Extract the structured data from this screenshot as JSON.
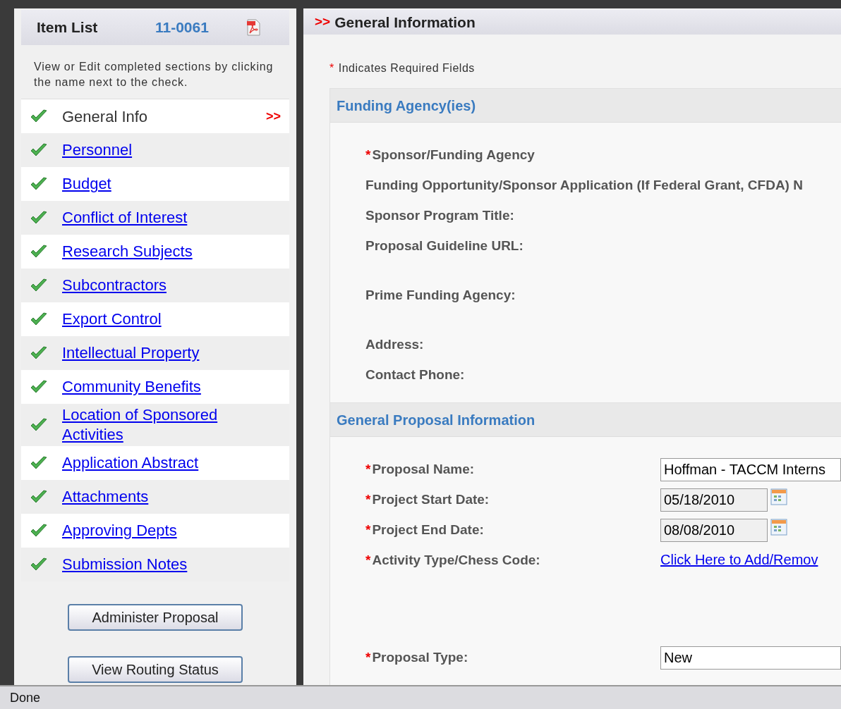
{
  "sidebar": {
    "title": "Item List",
    "proposal_number": "11-0061",
    "hint": "View or Edit completed sections by clicking the name next to the check.",
    "items": [
      {
        "label": "General Info",
        "complete": true,
        "selected": true,
        "marker": ">>"
      },
      {
        "label": "Personnel",
        "complete": true,
        "selected": false
      },
      {
        "label": "Budget",
        "complete": true,
        "selected": false
      },
      {
        "label": "Conflict of Interest",
        "complete": true,
        "selected": false
      },
      {
        "label": "Research Subjects",
        "complete": true,
        "selected": false
      },
      {
        "label": "Subcontractors",
        "complete": true,
        "selected": false
      },
      {
        "label": "Export Control",
        "complete": true,
        "selected": false
      },
      {
        "label": "Intellectual Property",
        "complete": true,
        "selected": false
      },
      {
        "label": "Community Benefits",
        "complete": true,
        "selected": false
      },
      {
        "label": "Location of Sponsored Activities",
        "complete": true,
        "selected": false
      },
      {
        "label": "Application Abstract",
        "complete": true,
        "selected": false
      },
      {
        "label": "Attachments",
        "complete": true,
        "selected": false
      },
      {
        "label": "Approving Depts",
        "complete": true,
        "selected": false
      },
      {
        "label": "Submission Notes",
        "complete": true,
        "selected": false
      }
    ],
    "buttons": [
      "Administer Proposal",
      "View Routing Status"
    ]
  },
  "main": {
    "marker": ">>",
    "title": "General Information",
    "required_note": "Indicates Required Fields",
    "required_mark": "*",
    "sections": [
      {
        "title": "Funding Agency(ies)",
        "fields": [
          {
            "label": "Sponsor/Funding Agency",
            "required": true
          },
          {
            "label": "Funding Opportunity/Sponsor Application (If Federal Grant, CFDA) N",
            "required": false
          },
          {
            "label": "Sponsor Program Title:",
            "required": false
          },
          {
            "label": "Proposal Guideline URL:",
            "required": false,
            "kind": "tall"
          },
          {
            "label": "Prime Funding Agency:",
            "required": false,
            "kind": "tall"
          },
          {
            "label": "Address:",
            "required": false
          },
          {
            "label": "Contact Phone:",
            "required": false
          }
        ]
      },
      {
        "title": "General Proposal Information",
        "fields": [
          {
            "label": "Proposal Name:",
            "required": true,
            "kind": "text",
            "value": "Hoffman - TACCM Interns"
          },
          {
            "label": "Project Start Date:",
            "required": true,
            "kind": "date",
            "value": "05/18/2010"
          },
          {
            "label": "Project End Date:",
            "required": true,
            "kind": "date",
            "value": "08/08/2010"
          },
          {
            "label": "Activity Type/Chess Code:",
            "required": true,
            "kind": "link",
            "value": "Click Here to Add/Remov"
          },
          {
            "label": "Proposal Type:",
            "required": true,
            "kind": "text",
            "value": "New"
          }
        ]
      }
    ]
  },
  "status_bar": {
    "text": "Done"
  }
}
